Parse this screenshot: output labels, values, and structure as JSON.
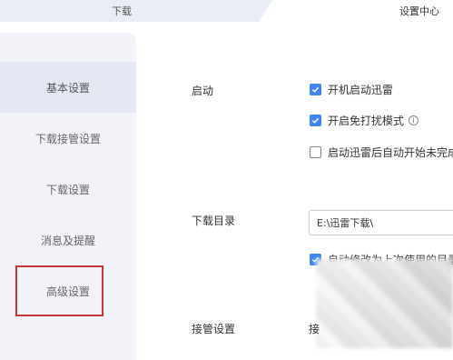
{
  "tabs": {
    "download": "下载",
    "settings": "设置中心"
  },
  "sidebar": {
    "items": [
      {
        "label": "基本设置"
      },
      {
        "label": "下载接管设置"
      },
      {
        "label": "下载设置"
      },
      {
        "label": "消息及提醒"
      },
      {
        "label": "高级设置"
      }
    ]
  },
  "startup": {
    "label": "启动",
    "opt1": "开机启动迅雷",
    "opt2": "开启免打扰模式",
    "opt3": "启动迅雷后自动开始未完成"
  },
  "download_dir": {
    "label": "下载目录",
    "path": "E:\\迅雷下载\\",
    "auto_change": "自动修改为上次使用的目录"
  },
  "takeover": {
    "label": "接管设置",
    "partial": "接"
  },
  "colors": {
    "accent": "#3e86f5",
    "highlight": "#c9373a"
  }
}
